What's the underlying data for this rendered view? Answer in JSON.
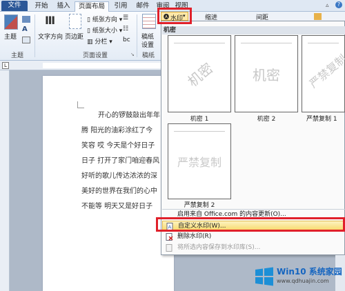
{
  "tabs": [
    "文件",
    "开始",
    "插入",
    "页面布局",
    "引用",
    "邮件",
    "审阅",
    "视图"
  ],
  "ribbon": {
    "theme": {
      "label": "主题",
      "group": "主题"
    },
    "text_direction": "文字方向",
    "margins": "页边距",
    "orientation": "纸张方向",
    "size": "纸张大小",
    "columns": "分栏",
    "page_setup_group": "页面设置",
    "manuscript": {
      "line1": "稿纸",
      "line2": "设置",
      "group": "稿纸"
    },
    "watermark_button": "水印",
    "indent": "缩进",
    "spacing": "间距"
  },
  "dropdown": {
    "section_title": "机密",
    "thumbnails": [
      {
        "label": "机密 1",
        "watermark": "机密"
      },
      {
        "label": "机密 2",
        "watermark": "机密"
      },
      {
        "label": "严禁复制 1",
        "watermark": "严禁复制"
      },
      {
        "label": "严禁复制 2",
        "watermark": "严禁复制"
      }
    ],
    "menu": [
      {
        "label": "启用来自 Office.com 的内容更新(O)..."
      },
      {
        "label": "自定义水印(W)..."
      },
      {
        "label": "删除水印(R)"
      },
      {
        "label": "将所选内容保存到水印库(S)..."
      }
    ]
  },
  "document": {
    "lines": [
      "开心的锣鼓敲出年年",
      "腾 阳光的油彩涂红了今",
      "笑容 哎 今天是个好日子",
      "日子 打开了家门咱迎春风",
      "好听的歌儿传达浓浓的深",
      "美好的世界在我们的心中",
      "不能等 明天又是好日子"
    ]
  },
  "logo": {
    "brand": "Win10 系统家园",
    "url": "www.qdhuajin.com"
  },
  "colors": {
    "highlight_red": "#e0202a",
    "file_tab": "#2b5797",
    "menu_highlight": "#f7d96b"
  }
}
